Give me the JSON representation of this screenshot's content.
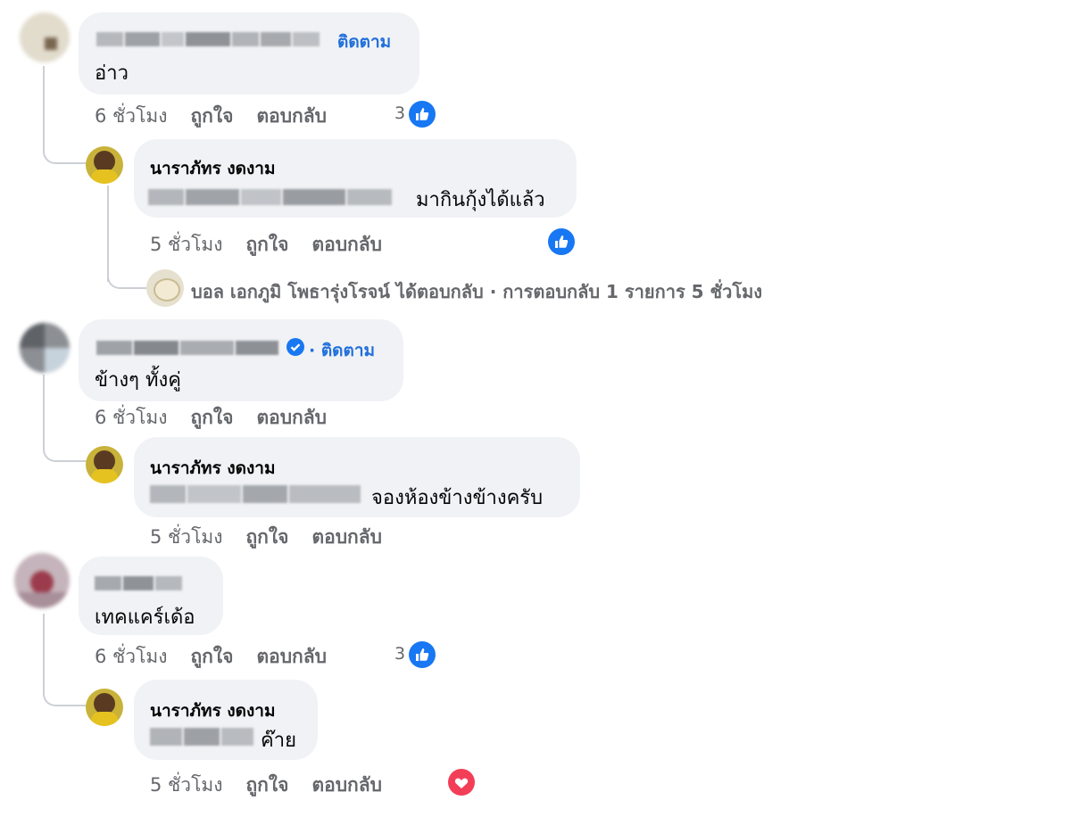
{
  "comments": [
    {
      "name_hidden": true,
      "follow": "ติดตาม",
      "text": "อ่าว",
      "meta": {
        "time": "6 ชั่วโมง",
        "like": "ถูกใจ",
        "reply": "ตอบกลับ"
      },
      "reactions": {
        "count": "3",
        "icon": "like-icon"
      },
      "reply": {
        "name": "นาราภัทร งดงาม",
        "text": "มากินกุ้งได้แล้ว",
        "meta": {
          "time": "5 ชั่วโมง",
          "like": "ถูกใจ",
          "reply": "ตอบกลับ"
        },
        "reactions": {
          "icon": "like-icon"
        },
        "more_replies": "บอล เอกภูมิ โพธารุ่งโรจน์ ได้ตอบกลับ · การตอบกลับ 1 รายการ 5 ชั่วโมง"
      }
    },
    {
      "name_hidden": true,
      "verified": true,
      "follow": "· ติดตาม",
      "text": "ข้างๆ ทั้งคู่",
      "meta": {
        "time": "6 ชั่วโมง",
        "like": "ถูกใจ",
        "reply": "ตอบกลับ"
      },
      "reply": {
        "name": "นาราภัทร งดงาม",
        "text": "จองห้องข้างข้างครับ",
        "meta": {
          "time": "5 ชั่วโมง",
          "like": "ถูกใจ",
          "reply": "ตอบกลับ"
        }
      }
    },
    {
      "name_hidden": true,
      "text": "เทคแคร์เด้อ",
      "meta": {
        "time": "6 ชั่วโมง",
        "like": "ถูกใจ",
        "reply": "ตอบกลับ"
      },
      "reactions": {
        "count": "3",
        "icon": "like-icon"
      },
      "reply": {
        "name": "นาราภัทร งดงาม",
        "text": "ค๊าย",
        "meta": {
          "time": "5 ชั่วโมง",
          "like": "ถูกใจ",
          "reply": "ตอบกลับ"
        },
        "reactions": {
          "icon": "love-icon"
        }
      }
    }
  ],
  "colors": {
    "link": "#216fdb",
    "meta": "#65676b",
    "bubble": "#f0f2f5",
    "like": "#1877f2",
    "love": "#f33e58"
  }
}
